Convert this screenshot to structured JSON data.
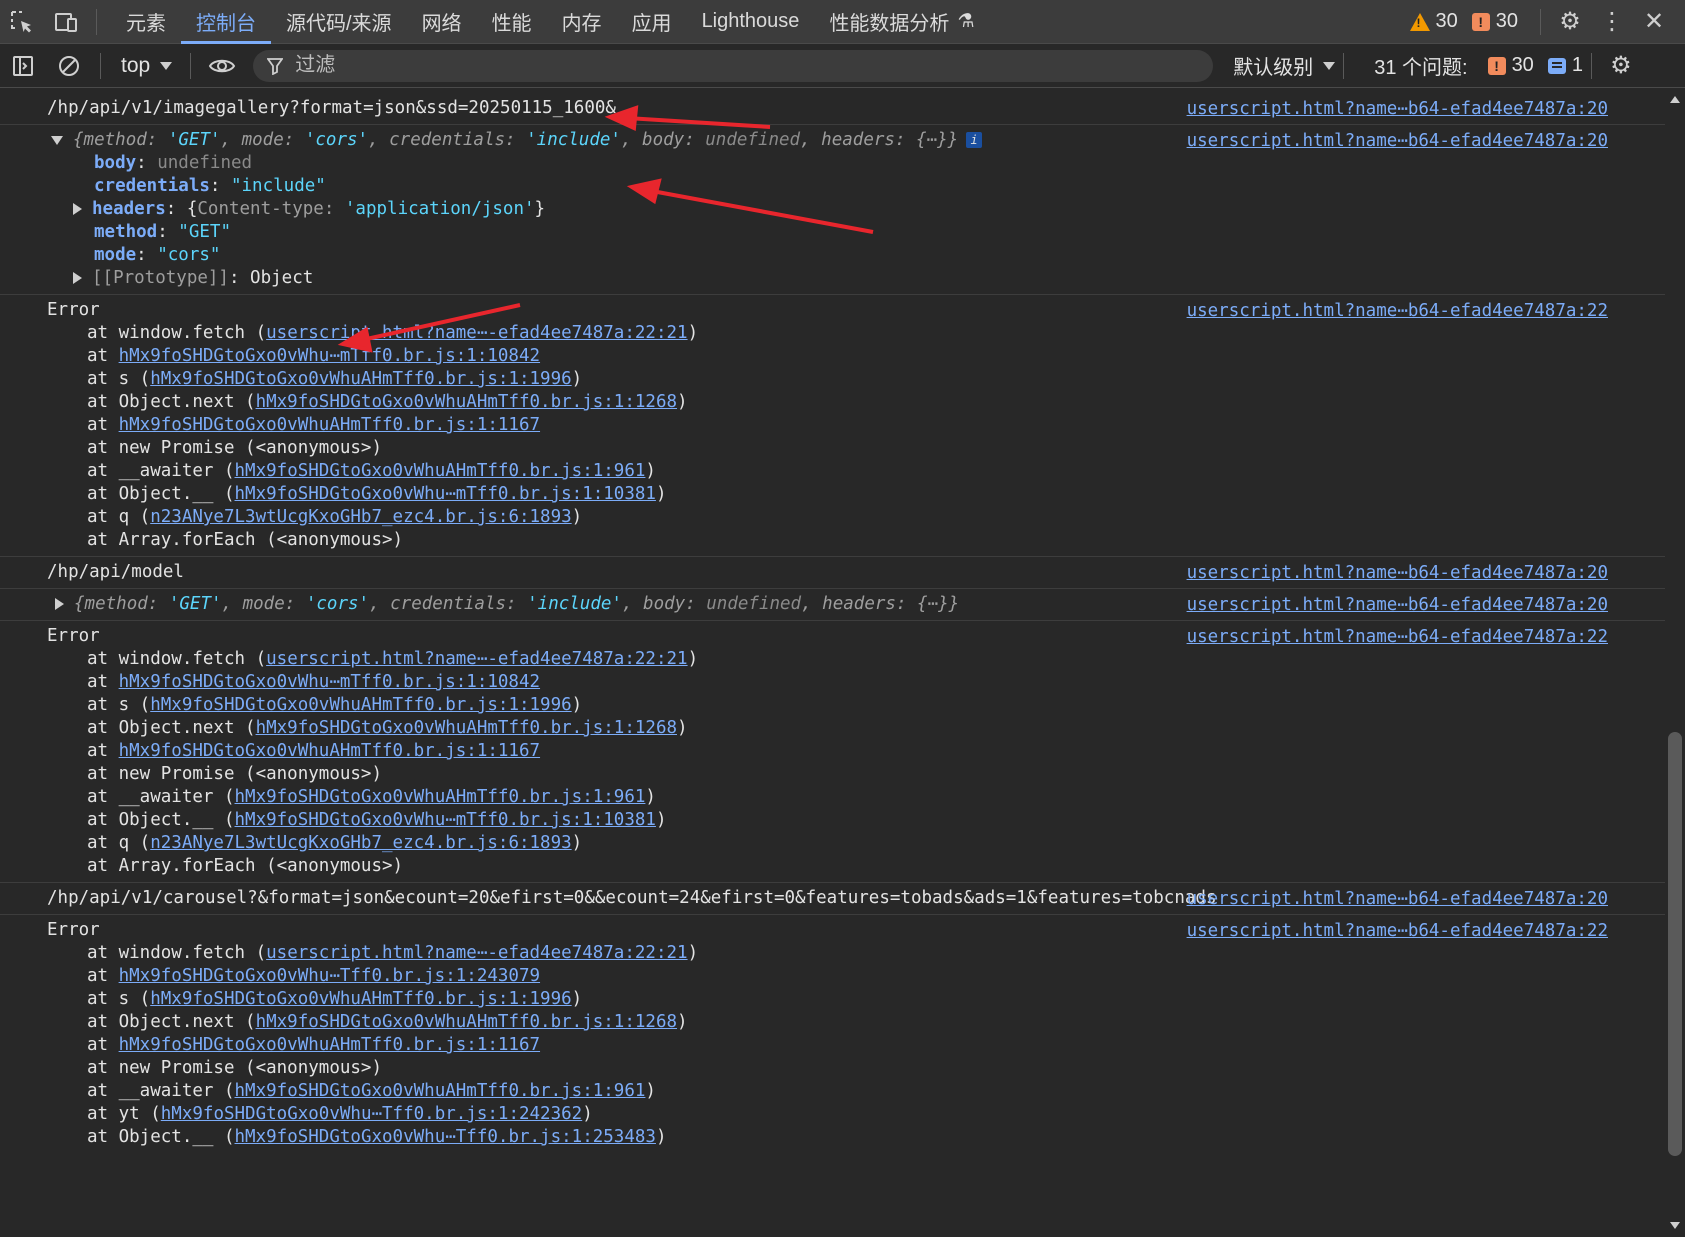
{
  "tabbar": {
    "tabs": [
      "元素",
      "控制台",
      "源代码/来源",
      "网络",
      "性能",
      "内存",
      "应用",
      "Lighthouse",
      "性能数据分析"
    ],
    "active_tab": "控制台",
    "warnings": "30",
    "errors": "30"
  },
  "console_toolbar": {
    "context": "top",
    "filter_placeholder": "过滤",
    "levels": "默认级别",
    "issues_label": "31 个问题:",
    "issues_errors": "30",
    "issues_info": "1"
  },
  "colors": {
    "accent": "#7cacf8",
    "warning": "#f29900",
    "error": "#f28b5c",
    "annotation_arrow": "#e8262d"
  },
  "messages": {
    "m1": {
      "text": "/hp/api/v1/imagegallery?format=json&ssd=20250115_1600&",
      "source": "userscript.html?name⋯b64-efad4ee7487a:20"
    },
    "m2": {
      "source": "userscript.html?name⋯b64-efad4ee7487a:20",
      "preview": {
        "k_method": "method",
        "v_method": "'GET'",
        "k_mode": "mode",
        "v_mode": "'cors'",
        "k_credentials": "credentials",
        "v_credentials": "'include'",
        "k_body": "body",
        "v_body": "undefined",
        "k_headers": "headers",
        "v_headers": "{⋯}"
      },
      "info_badge": "i",
      "props": {
        "body_k": "body",
        "body_v": "undefined",
        "cred_k": "credentials",
        "cred_v": "\"include\"",
        "headers_k": "headers",
        "headers_ck": "Content-type",
        "headers_cv": "'application/json'",
        "method_k": "method",
        "method_v": "\"GET\"",
        "mode_k": "mode",
        "mode_v": "\"cors\"",
        "proto_k": "[[Prototype]]",
        "proto_v": "Object"
      }
    },
    "m3": {
      "source": "userscript.html?name⋯b64-efad4ee7487a:22",
      "title": "Error",
      "frames": [
        {
          "prefix": "at window.fetch (",
          "link": "userscript.html?name⋯-efad4ee7487a:22:21",
          "suffix": ")"
        },
        {
          "prefix": "at ",
          "link": "hMx9foSHDGtoGxo0vWhu⋯mTff0.br.js:1:10842",
          "suffix": ""
        },
        {
          "prefix": "at s (",
          "link": "hMx9foSHDGtoGxo0vWhuAHmTff0.br.js:1:1996",
          "suffix": ")"
        },
        {
          "prefix": "at Object.next (",
          "link": "hMx9foSHDGtoGxo0vWhuAHmTff0.br.js:1:1268",
          "suffix": ")"
        },
        {
          "prefix": "at ",
          "link": "hMx9foSHDGtoGxo0vWhuAHmTff0.br.js:1:1167",
          "suffix": ""
        },
        {
          "prefix": "at new Promise (<anonymous>)",
          "link": "",
          "suffix": ""
        },
        {
          "prefix": "at __awaiter (",
          "link": "hMx9foSHDGtoGxo0vWhuAHmTff0.br.js:1:961",
          "suffix": ")"
        },
        {
          "prefix": "at Object.__ (",
          "link": "hMx9foSHDGtoGxo0vWhu⋯mTff0.br.js:1:10381",
          "suffix": ")"
        },
        {
          "prefix": "at q (",
          "link": "n23ANye7L3wtUcgKxoGHb7_ezc4.br.js:6:1893",
          "suffix": ")"
        },
        {
          "prefix": "at Array.forEach (<anonymous>)",
          "link": "",
          "suffix": ""
        }
      ]
    },
    "m4": {
      "text": "/hp/api/model",
      "source": "userscript.html?name⋯b64-efad4ee7487a:20"
    },
    "m5": {
      "source": "userscript.html?name⋯b64-efad4ee7487a:20"
    },
    "m6": {
      "source": "userscript.html?name⋯b64-efad4ee7487a:22",
      "title": "Error",
      "frames": [
        {
          "prefix": "at window.fetch (",
          "link": "userscript.html?name⋯-efad4ee7487a:22:21",
          "suffix": ")"
        },
        {
          "prefix": "at ",
          "link": "hMx9foSHDGtoGxo0vWhu⋯mTff0.br.js:1:10842",
          "suffix": ""
        },
        {
          "prefix": "at s (",
          "link": "hMx9foSHDGtoGxo0vWhuAHmTff0.br.js:1:1996",
          "suffix": ")"
        },
        {
          "prefix": "at Object.next (",
          "link": "hMx9foSHDGtoGxo0vWhuAHmTff0.br.js:1:1268",
          "suffix": ")"
        },
        {
          "prefix": "at ",
          "link": "hMx9foSHDGtoGxo0vWhuAHmTff0.br.js:1:1167",
          "suffix": ""
        },
        {
          "prefix": "at new Promise (<anonymous>)",
          "link": "",
          "suffix": ""
        },
        {
          "prefix": "at __awaiter (",
          "link": "hMx9foSHDGtoGxo0vWhuAHmTff0.br.js:1:961",
          "suffix": ")"
        },
        {
          "prefix": "at Object.__ (",
          "link": "hMx9foSHDGtoGxo0vWhu⋯mTff0.br.js:1:10381",
          "suffix": ")"
        },
        {
          "prefix": "at q (",
          "link": "n23ANye7L3wtUcgKxoGHb7_ezc4.br.js:6:1893",
          "suffix": ")"
        },
        {
          "prefix": "at Array.forEach (<anonymous>)",
          "link": "",
          "suffix": ""
        }
      ]
    },
    "m7": {
      "text": "/hp/api/v1/carousel?&format=json&ecount=20&efirst=0&&ecount=24&efirst=0&features=tobads&ads=1&features=tobcnads",
      "source": "userscript.html?name⋯b64-efad4ee7487a:20"
    },
    "m8": {
      "source": "userscript.html?name⋯b64-efad4ee7487a:22",
      "title": "Error",
      "frames": [
        {
          "prefix": "at window.fetch (",
          "link": "userscript.html?name⋯-efad4ee7487a:22:21",
          "suffix": ")"
        },
        {
          "prefix": "at ",
          "link": "hMx9foSHDGtoGxo0vWhu⋯Tff0.br.js:1:243079",
          "suffix": ""
        },
        {
          "prefix": "at s (",
          "link": "hMx9foSHDGtoGxo0vWhuAHmTff0.br.js:1:1996",
          "suffix": ")"
        },
        {
          "prefix": "at Object.next (",
          "link": "hMx9foSHDGtoGxo0vWhuAHmTff0.br.js:1:1268",
          "suffix": ")"
        },
        {
          "prefix": "at ",
          "link": "hMx9foSHDGtoGxo0vWhuAHmTff0.br.js:1:1167",
          "suffix": ""
        },
        {
          "prefix": "at new Promise (<anonymous>)",
          "link": "",
          "suffix": ""
        },
        {
          "prefix": "at __awaiter (",
          "link": "hMx9foSHDGtoGxo0vWhuAHmTff0.br.js:1:961",
          "suffix": ")"
        },
        {
          "prefix": "at yt (",
          "link": "hMx9foSHDGtoGxo0vWhu⋯Tff0.br.js:1:242362",
          "suffix": ")"
        },
        {
          "prefix": "at Object.__ (",
          "link": "hMx9foSHDGtoGxo0vWhu⋯Tff0.br.js:1:253483",
          "suffix": ")"
        }
      ]
    }
  }
}
